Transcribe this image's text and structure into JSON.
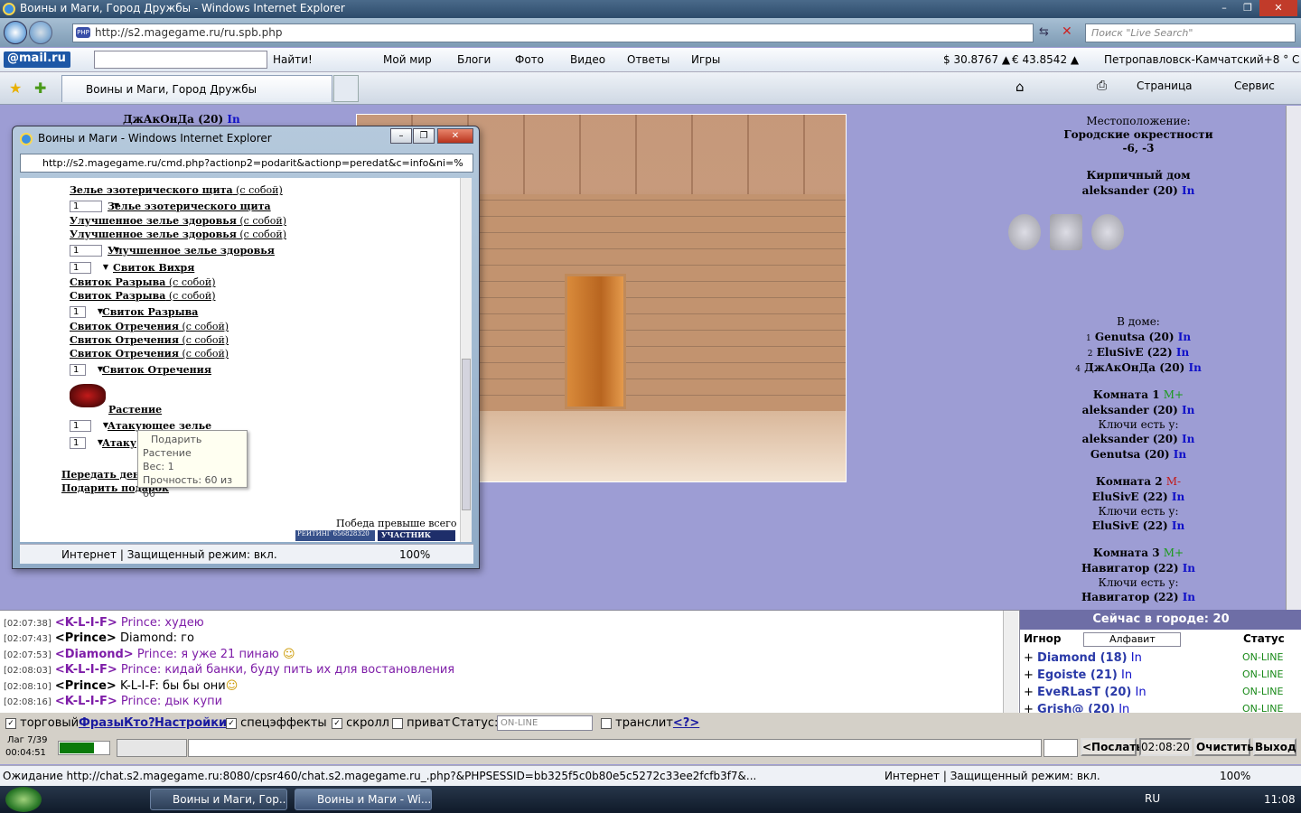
{
  "window": {
    "title": "Воины и Маги, Город Дружбы - Windows Internet Explorer"
  },
  "address": {
    "url": "http://s2.magegame.ru/ru.spb.php",
    "search_placeholder": "Поиск \"Live Search\""
  },
  "toolbar": {
    "mailru": "@mail.ru",
    "find": "Найти!",
    "items": [
      "Мой мир",
      "Блоги",
      "Фото",
      "Видео",
      "Ответы",
      "Игры"
    ],
    "usd": "$ 30.8767 ▲",
    "eur": "€ 43.8542 ▲",
    "weather": "Петропавловск-Камчатский+8 ° С"
  },
  "tabs": {
    "active": "Воины и Маги, Город Дружбы",
    "page_menu": "Страница",
    "service_menu": "Сервис"
  },
  "scene": {
    "top_name": "ДжАкОнДа (20)",
    "top_in": "In"
  },
  "right": {
    "location_label": "Местоположение:",
    "location_name": "Городские окрестности",
    "coords": "-6, -3",
    "building": "Кирпичный дом",
    "owner": "aleksander (20)",
    "in": "In",
    "in_house_label": "В доме:",
    "in_house": [
      {
        "num": "1",
        "name": "Genutsa (20)"
      },
      {
        "num": "2",
        "name": "EluSivE (22)"
      },
      {
        "num": "4",
        "name": "ДжАкОнДа (20)"
      }
    ],
    "room1": {
      "title": "Комната 1",
      "mark": "M+",
      "user": "aleksander (20)",
      "keys_label": "Ключи есть у:",
      "keys": [
        "aleksander (20)",
        "Genutsa (20)"
      ]
    },
    "room2": {
      "title": "Комната 2",
      "mark": "M-",
      "user": "EluSivE (22)",
      "keys_label": "Ключи есть у:",
      "keys": [
        "EluSivE (22)"
      ]
    },
    "room3": {
      "title": "Комната 3",
      "mark": "M+",
      "user": "Навигатор (22)",
      "keys_label": "Ключи есть у:",
      "keys": [
        "Навигатор (22)"
      ]
    }
  },
  "popup": {
    "title": "Воины и Маги - Windows Internet Explorer",
    "url": "http://s2.magegame.ru/cmd.php?actionp2=podarit&actionp=peredat&c=info&ni=%",
    "items": [
      {
        "text": "Зелье эзотерического щита",
        "suffix": " (с собой)"
      },
      {
        "text": "Зелье эзотерического щита",
        "qty": "1"
      },
      {
        "text": "Улучшенное зелье здоровья",
        "suffix": " (с собой)"
      },
      {
        "text": "Улучшенное зелье здоровья",
        "suffix": " (с собой)"
      },
      {
        "text": "Улучшенное зелье здоровья",
        "qty": "1"
      },
      {
        "text": "Свиток Вихря",
        "qty": "1"
      },
      {
        "text": "Свиток Разрыва",
        "suffix": " (с собой)"
      },
      {
        "text": "Свиток Разрыва",
        "suffix": " (с собой)"
      },
      {
        "text": "Свиток Разрыва",
        "qty": "1"
      },
      {
        "text": "Свиток Отречения",
        "suffix": " (с собой)"
      },
      {
        "text": "Свиток Отречения",
        "suffix": " (с собой)"
      },
      {
        "text": "Свиток Отречения",
        "suffix": " (с собой)"
      },
      {
        "text": "Свиток Отречения",
        "qty": "1"
      }
    ],
    "plant": "Растение",
    "attack1": "Атакующее зелье",
    "attack2": "Атаку",
    "qty": "1",
    "transfer_money": "Передать день",
    "gift": "Подарить подарок",
    "victory": "Победа превыше всего",
    "rating_badge": "РЕЙТИНГ 656828320",
    "participant_badge": "УЧАСТНИК",
    "status": "Интернет | Защищенный режим: вкл.",
    "zoom": "100%"
  },
  "tooltip": {
    "action": "Подарить",
    "name": "Растение",
    "weight": "Вес: 1",
    "durability": "Прочность: 60 из 60"
  },
  "chat": [
    {
      "ts": "[02:07:38]",
      "nick": "<K-L-I-F>",
      "text": " Prince: худею",
      "purple": true
    },
    {
      "ts": "[02:07:43]",
      "nick": "<Prince>",
      "text": " Diamond: го",
      "purple": false
    },
    {
      "ts": "[02:07:53]",
      "nick": "<Diamond>",
      "text": " Prince: я уже 21 пинаю",
      "purple": true
    },
    {
      "ts": "[02:08:03]",
      "nick": "<K-L-I-F>",
      "text": " Prince: кидай банки, буду пить их для востановления",
      "purple": true
    },
    {
      "ts": "[02:08:10]",
      "nick": "<Prince>",
      "text": " K-L-I-F: бы бы они",
      "purple": false
    },
    {
      "ts": "[02:08:16]",
      "nick": "<K-L-I-F>",
      "text": " Prince: дык купи",
      "purple": true
    }
  ],
  "online": {
    "header": "Сейчас в городе: 20",
    "ignore_label": "Игнор",
    "sort_option": "Алфавит",
    "status_label": "Статус",
    "users": [
      {
        "name": "Diamond (18)",
        "in": "In",
        "status": "ON-LINE"
      },
      {
        "name": "Egoiste (21)",
        "in": "In",
        "status": "ON-LINE"
      },
      {
        "name": "EveRLasT (20)",
        "in": "In",
        "status": "ON-LINE"
      },
      {
        "name": "Grish@ (20)",
        "in": "In",
        "status": "ON-LINE"
      }
    ]
  },
  "controls": {
    "trade": "торговый",
    "phrases": "Фразы",
    "who": "Кто?",
    "settings": "Настройки",
    "effects": "спецэффекты",
    "scroll": "скролл",
    "private": "приват",
    "status_label": "Статус:",
    "status_value": "ON-LINE",
    "translit": "транслит",
    "translit_help": "<?>",
    "lag": "Лаг 7/39",
    "timer": "00:04:51",
    "send": "<Послать",
    "clock": "02:08:20",
    "clear": "Очистить",
    "exit": "Выход"
  },
  "statusbar": {
    "loading": "Ожидание http://chat.s2.magegame.ru:8080/cpsr460/chat.s2.magegame.ru_.php?&PHPSESSID=bb325f5c0b80e5c5272c33ee2fcfb3f7&...",
    "zone": "Интернет | Защищенный режим: вкл.",
    "zoom": "100%"
  },
  "taskbar": {
    "tasks": [
      "Воины и Маги, Гор...",
      "Воины и Маги - Wi..."
    ],
    "lang": "RU",
    "time": "11:08"
  }
}
